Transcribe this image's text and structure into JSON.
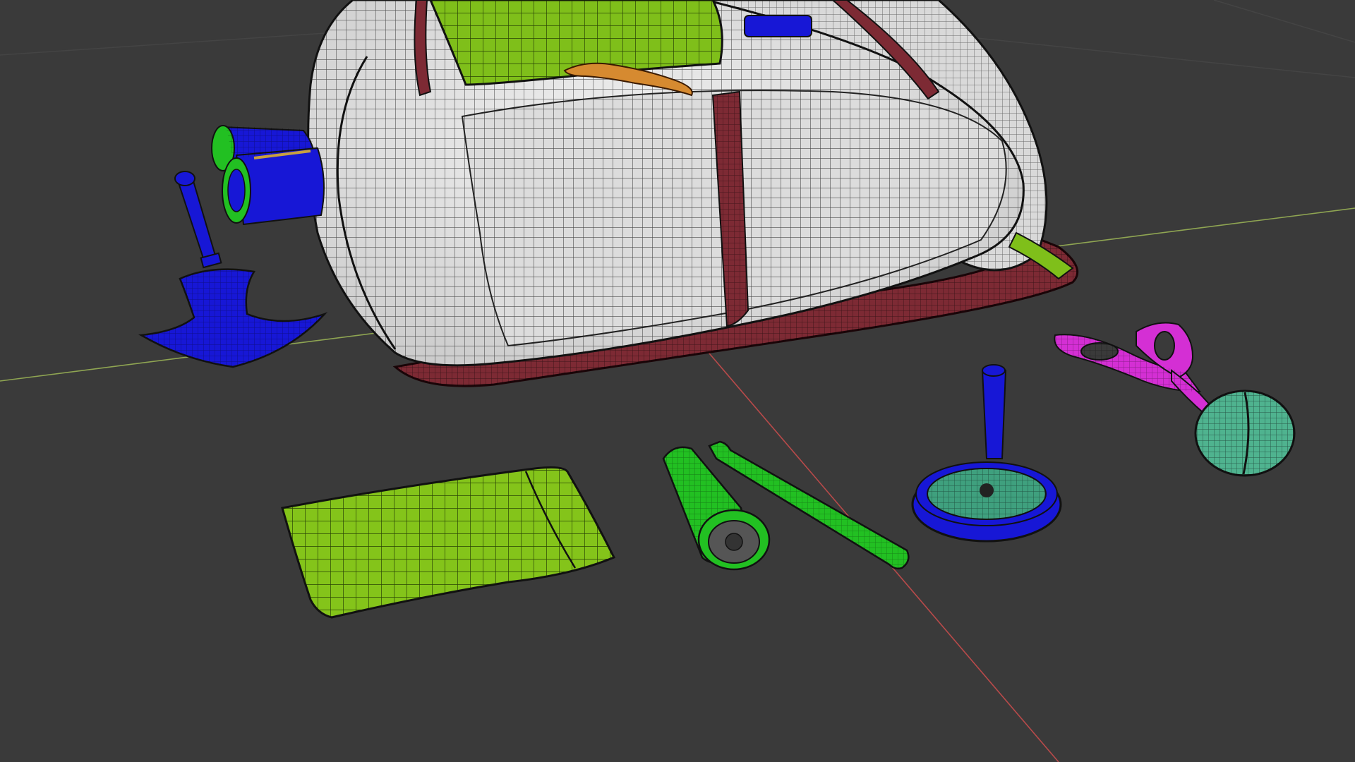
{
  "viewport": {
    "background": "#3a3a3a",
    "mode": "wireframe-on-shaded",
    "axes": {
      "x_color": "#b84a4a",
      "y_color": "#8fa552"
    }
  },
  "objects": [
    {
      "name": "backpack",
      "colors": [
        "#e9e9e9",
        "#7d2a34",
        "#7fbf1a"
      ]
    },
    {
      "name": "rolled-cylinders",
      "colors": [
        "#1717d6",
        "#22c022"
      ]
    },
    {
      "name": "ice-axe",
      "colors": [
        "#1717d6"
      ]
    },
    {
      "name": "pouch",
      "colors": [
        "#84c41a"
      ]
    },
    {
      "name": "flashlight",
      "colors": [
        "#22c022"
      ]
    },
    {
      "name": "pen",
      "colors": [
        "#22c022"
      ]
    },
    {
      "name": "magnifying-glass",
      "colors": [
        "#1717d6",
        "#3fa07e"
      ]
    },
    {
      "name": "scissors",
      "colors": [
        "#d42fd4"
      ]
    },
    {
      "name": "ball",
      "colors": [
        "#4fb38f"
      ]
    }
  ]
}
